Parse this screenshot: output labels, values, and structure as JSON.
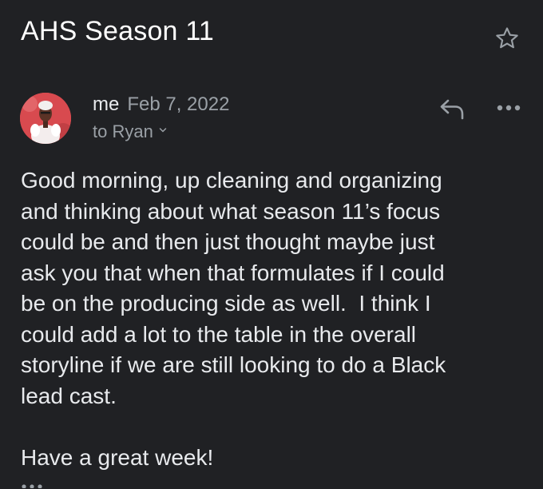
{
  "email": {
    "subject": "AHS Season 11",
    "sender": {
      "name": "me",
      "date": "Feb 7, 2022",
      "to": "to Ryan"
    },
    "body_lines_p1": [
      "Good morning, up cleaning and organizing",
      "and thinking about what season 11’s focus",
      "could be and then just thought maybe just",
      "ask you that when that formulates if I could",
      "be on the producing side as well.  I think I",
      "could add a lot to the table in the overall",
      "storyline if we are still looking to do a Black",
      "lead cast."
    ],
    "body_closing": "Have a great week!"
  },
  "icons": {
    "star": "star-outline-icon",
    "reply": "reply-arrow-icon",
    "more": "more-horizontal-icon",
    "recipient_toggle": "chevron-down-icon",
    "trimmed_content": "ellipsis-icon"
  },
  "colors": {
    "background": "#202124",
    "primary_text": "#e8eaed",
    "secondary_text": "#9aa0a6",
    "avatar_bg": "#d84a4f"
  }
}
